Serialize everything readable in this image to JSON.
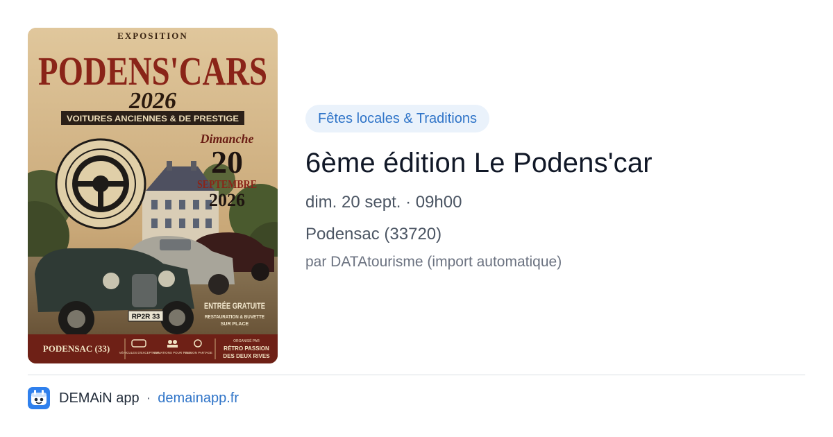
{
  "poster": {
    "image_name": "event-poster",
    "top_label": "EXPOSITION",
    "brand": "PODENS'CARS",
    "year": "2026",
    "subtitle": "VOITURES ANCIENNES & DE PRESTIGE",
    "day": "Dimanche",
    "date_number": "20",
    "month": "SEPTEMBRE",
    "date_year": "2026",
    "club": "RÉTRO PASSION DES DEUX RIVES",
    "plate": "RP2R 33",
    "entry": "ENTRÉE GRATUITE",
    "entry_detail_1": "RESTAURATION & BUVETTE",
    "entry_detail_2": "SUR PLACE",
    "town": "PODENSAC (33)",
    "feature_1": "VÉHICULES D'EXCEPTION",
    "feature_2": "ANIMATIONS POUR TOUS",
    "feature_3": "PASSION PARTAGE",
    "organizer_label": "ORGANISÉ PAR",
    "organizer_1": "RÉTRO PASSION",
    "organizer_2": "DES DEUX RIVES"
  },
  "event": {
    "category": "Fêtes locales & Traditions",
    "title": "6ème édition Le Podens'car",
    "datetime": "dim. 20 sept. · 09h00",
    "place": "Podensac (33720)",
    "source": "par DATAtourisme (import automatique)"
  },
  "footer": {
    "app_name": "DEMAiN app",
    "separator": "·",
    "link": "demainapp.fr"
  },
  "colors": {
    "accent": "#2f74c8",
    "badge_bg": "#eaf2fb",
    "poster_red": "#8a2418",
    "poster_brown": "#3a2412"
  }
}
